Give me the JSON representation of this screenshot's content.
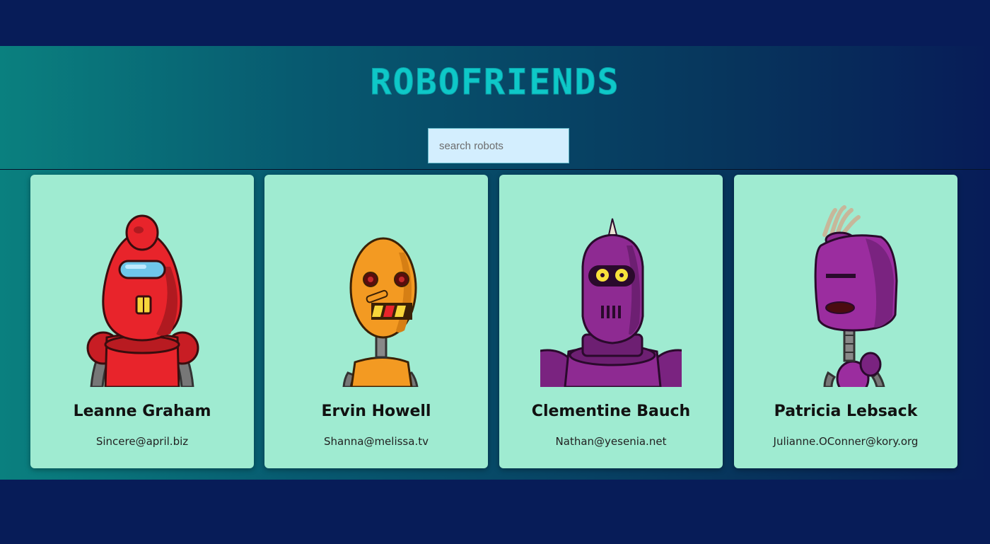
{
  "header": {
    "title": "ROBOFRIENDS",
    "search": {
      "placeholder": "search robots",
      "value": ""
    }
  },
  "robots": [
    {
      "name": "Leanne Graham",
      "email": "Sincere@april.biz",
      "image": "red-robot-icon",
      "color": "#e8242b"
    },
    {
      "name": "Ervin Howell",
      "email": "Shanna@melissa.tv",
      "image": "orange-robot-icon",
      "color": "#f39a22"
    },
    {
      "name": "Clementine Bauch",
      "email": "Nathan@yesenia.net",
      "image": "purple-robot-icon",
      "color": "#8e2a92"
    },
    {
      "name": "Patricia Lebsack",
      "email": "Julianne.OConner@kory.org",
      "image": "purple-square-robot-icon",
      "color": "#9b2d9f"
    }
  ],
  "colors": {
    "page_background": "#071c58",
    "card_background": "#9febd1",
    "title": "#0ec8c8",
    "search_background": "#d3eefe"
  }
}
